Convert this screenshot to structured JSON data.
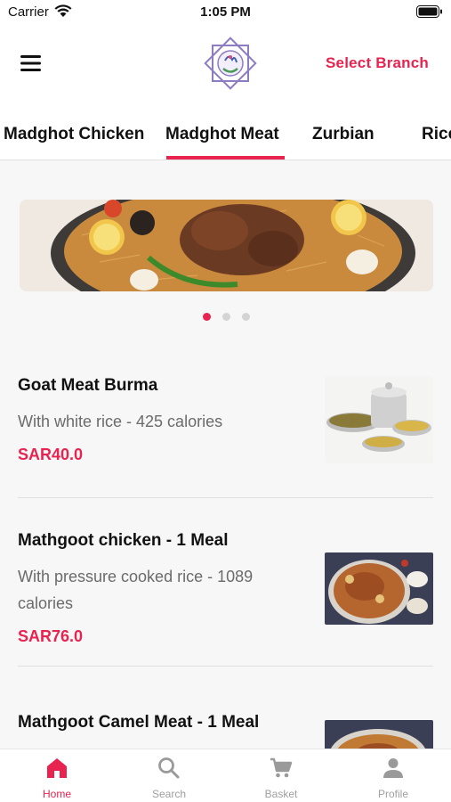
{
  "status_bar": {
    "carrier": "Carrier",
    "time": "1:05 PM"
  },
  "header": {
    "select_branch_label": "Select Branch"
  },
  "category_tabs": [
    {
      "label": "Madghot Chicken",
      "active": false
    },
    {
      "label": "Madghot Meat",
      "active": true
    },
    {
      "label": "Zurbian",
      "active": false
    },
    {
      "label": "Rice",
      "active": false
    }
  ],
  "carousel": {
    "slide_count": 3,
    "active_index": 0
  },
  "menu_items": [
    {
      "name": "Goat Meat Burma",
      "description": "With white rice - 425 calories",
      "price": "SAR40.0"
    },
    {
      "name": "Mathgoot chicken - 1 Meal",
      "description": "With pressure cooked rice - 1089 calories",
      "price": "SAR76.0"
    },
    {
      "name": "Mathgoot Camel Meat - 1 Meal",
      "description": "",
      "price": ""
    }
  ],
  "tab_bar": [
    {
      "label": "Home",
      "icon": "home-icon",
      "active": true
    },
    {
      "label": "Search",
      "icon": "search-icon",
      "active": false
    },
    {
      "label": "Basket",
      "icon": "basket-icon",
      "active": false
    },
    {
      "label": "Profile",
      "icon": "profile-icon",
      "active": false
    }
  ],
  "colors": {
    "accent": "#e8234f",
    "inactive": "#a0a0a0",
    "logo": "#8e7cc3"
  }
}
